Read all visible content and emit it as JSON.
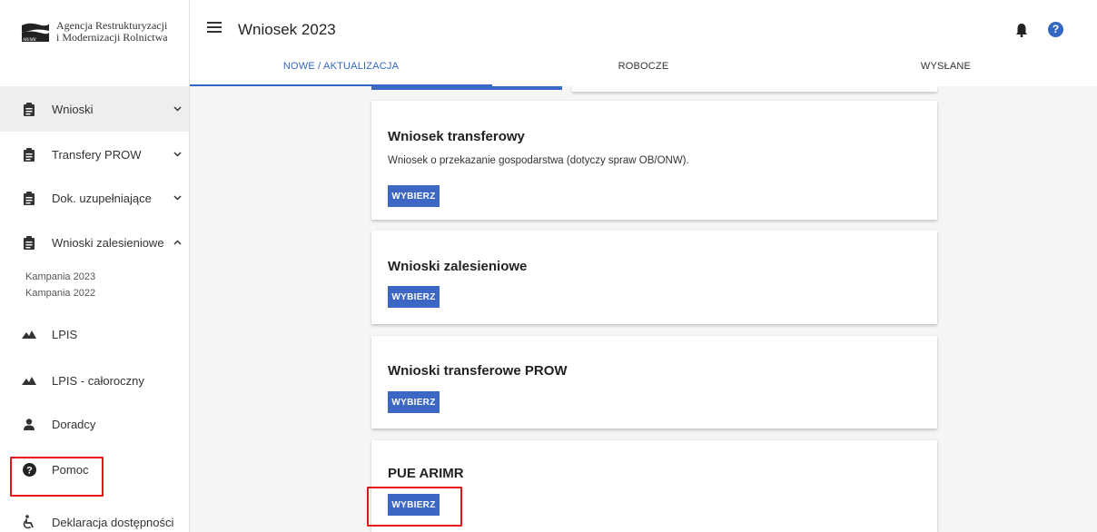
{
  "logo": {
    "line1": "Agencja Restrukturyzacji",
    "line2": "i Modernizacji Rolnictwa",
    "mark": "ARiMR"
  },
  "sidebar": {
    "items": [
      {
        "label": "Wnioski",
        "icon": "clipboard-icon"
      },
      {
        "label": "Transfery PROW",
        "icon": "clipboard-icon"
      },
      {
        "label": "Dok. uzupełniające",
        "icon": "clipboard-icon"
      },
      {
        "label": "Wnioski zalesieniowe",
        "icon": "clipboard-icon"
      },
      {
        "label": "LPIS",
        "icon": "terrain-icon"
      },
      {
        "label": "LPIS - całoroczny",
        "icon": "terrain-icon"
      },
      {
        "label": "Doradcy",
        "icon": "person-icon"
      },
      {
        "label": "Pomoc",
        "icon": "help-circle-icon"
      },
      {
        "label": "Deklaracja dostępności",
        "icon": "accessibility-icon"
      }
    ],
    "subitems": [
      "Kampania 2023",
      "Kampania 2022"
    ]
  },
  "header": {
    "title": "Wniosek 2023",
    "help_glyph": "?"
  },
  "tabs": [
    {
      "label": "NOWE / AKTUALIZACJA"
    },
    {
      "label": "ROBOCZE"
    },
    {
      "label": "WYSŁANE"
    }
  ],
  "cards": [
    {
      "title": "Wniosek transferowy",
      "description": "Wniosek o przekazanie gospodarstwa (dotyczy spraw OB/ONW).",
      "button": "WYBIERZ"
    },
    {
      "title": "Wnioski zalesieniowe",
      "button": "WYBIERZ"
    },
    {
      "title": "Wnioski transferowe PROW",
      "button": "WYBIERZ"
    },
    {
      "title": "PUE ARIMR",
      "button": "WYBIERZ"
    }
  ],
  "colors": {
    "accent": "#3367c2",
    "button": "#3d67c5",
    "highlight": "#e5131a"
  }
}
